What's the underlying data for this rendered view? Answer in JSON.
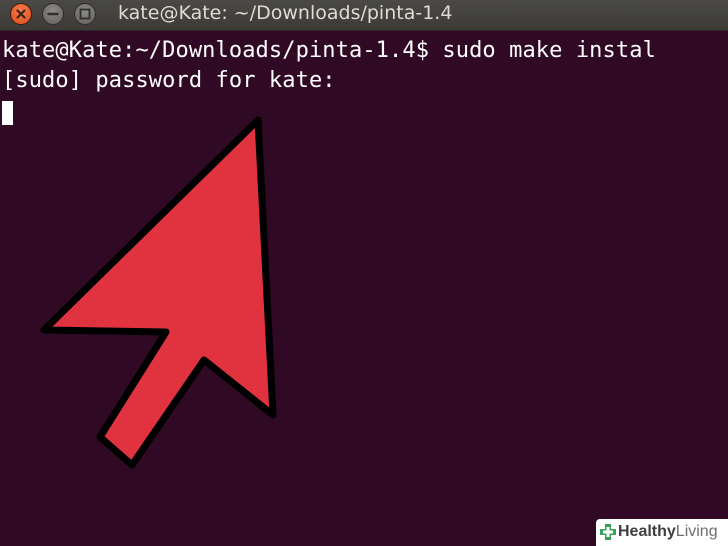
{
  "window": {
    "title": "kate@Kate: ~/Downloads/pinta-1.4",
    "controls": [
      "close-icon",
      "minimize-icon",
      "maximize-icon"
    ]
  },
  "terminal": {
    "lines": [
      "kate@Kate:~/Downloads/pinta-1.4$ sudo make instal",
      "[sudo] password for kate:"
    ],
    "background": "#300a24",
    "text_color": "#ffffff"
  },
  "overlay": {
    "icon": "pointer-arrow-icon",
    "color": "#e0333f"
  },
  "watermark": {
    "word1": "Healthy",
    "word2": "Living"
  }
}
